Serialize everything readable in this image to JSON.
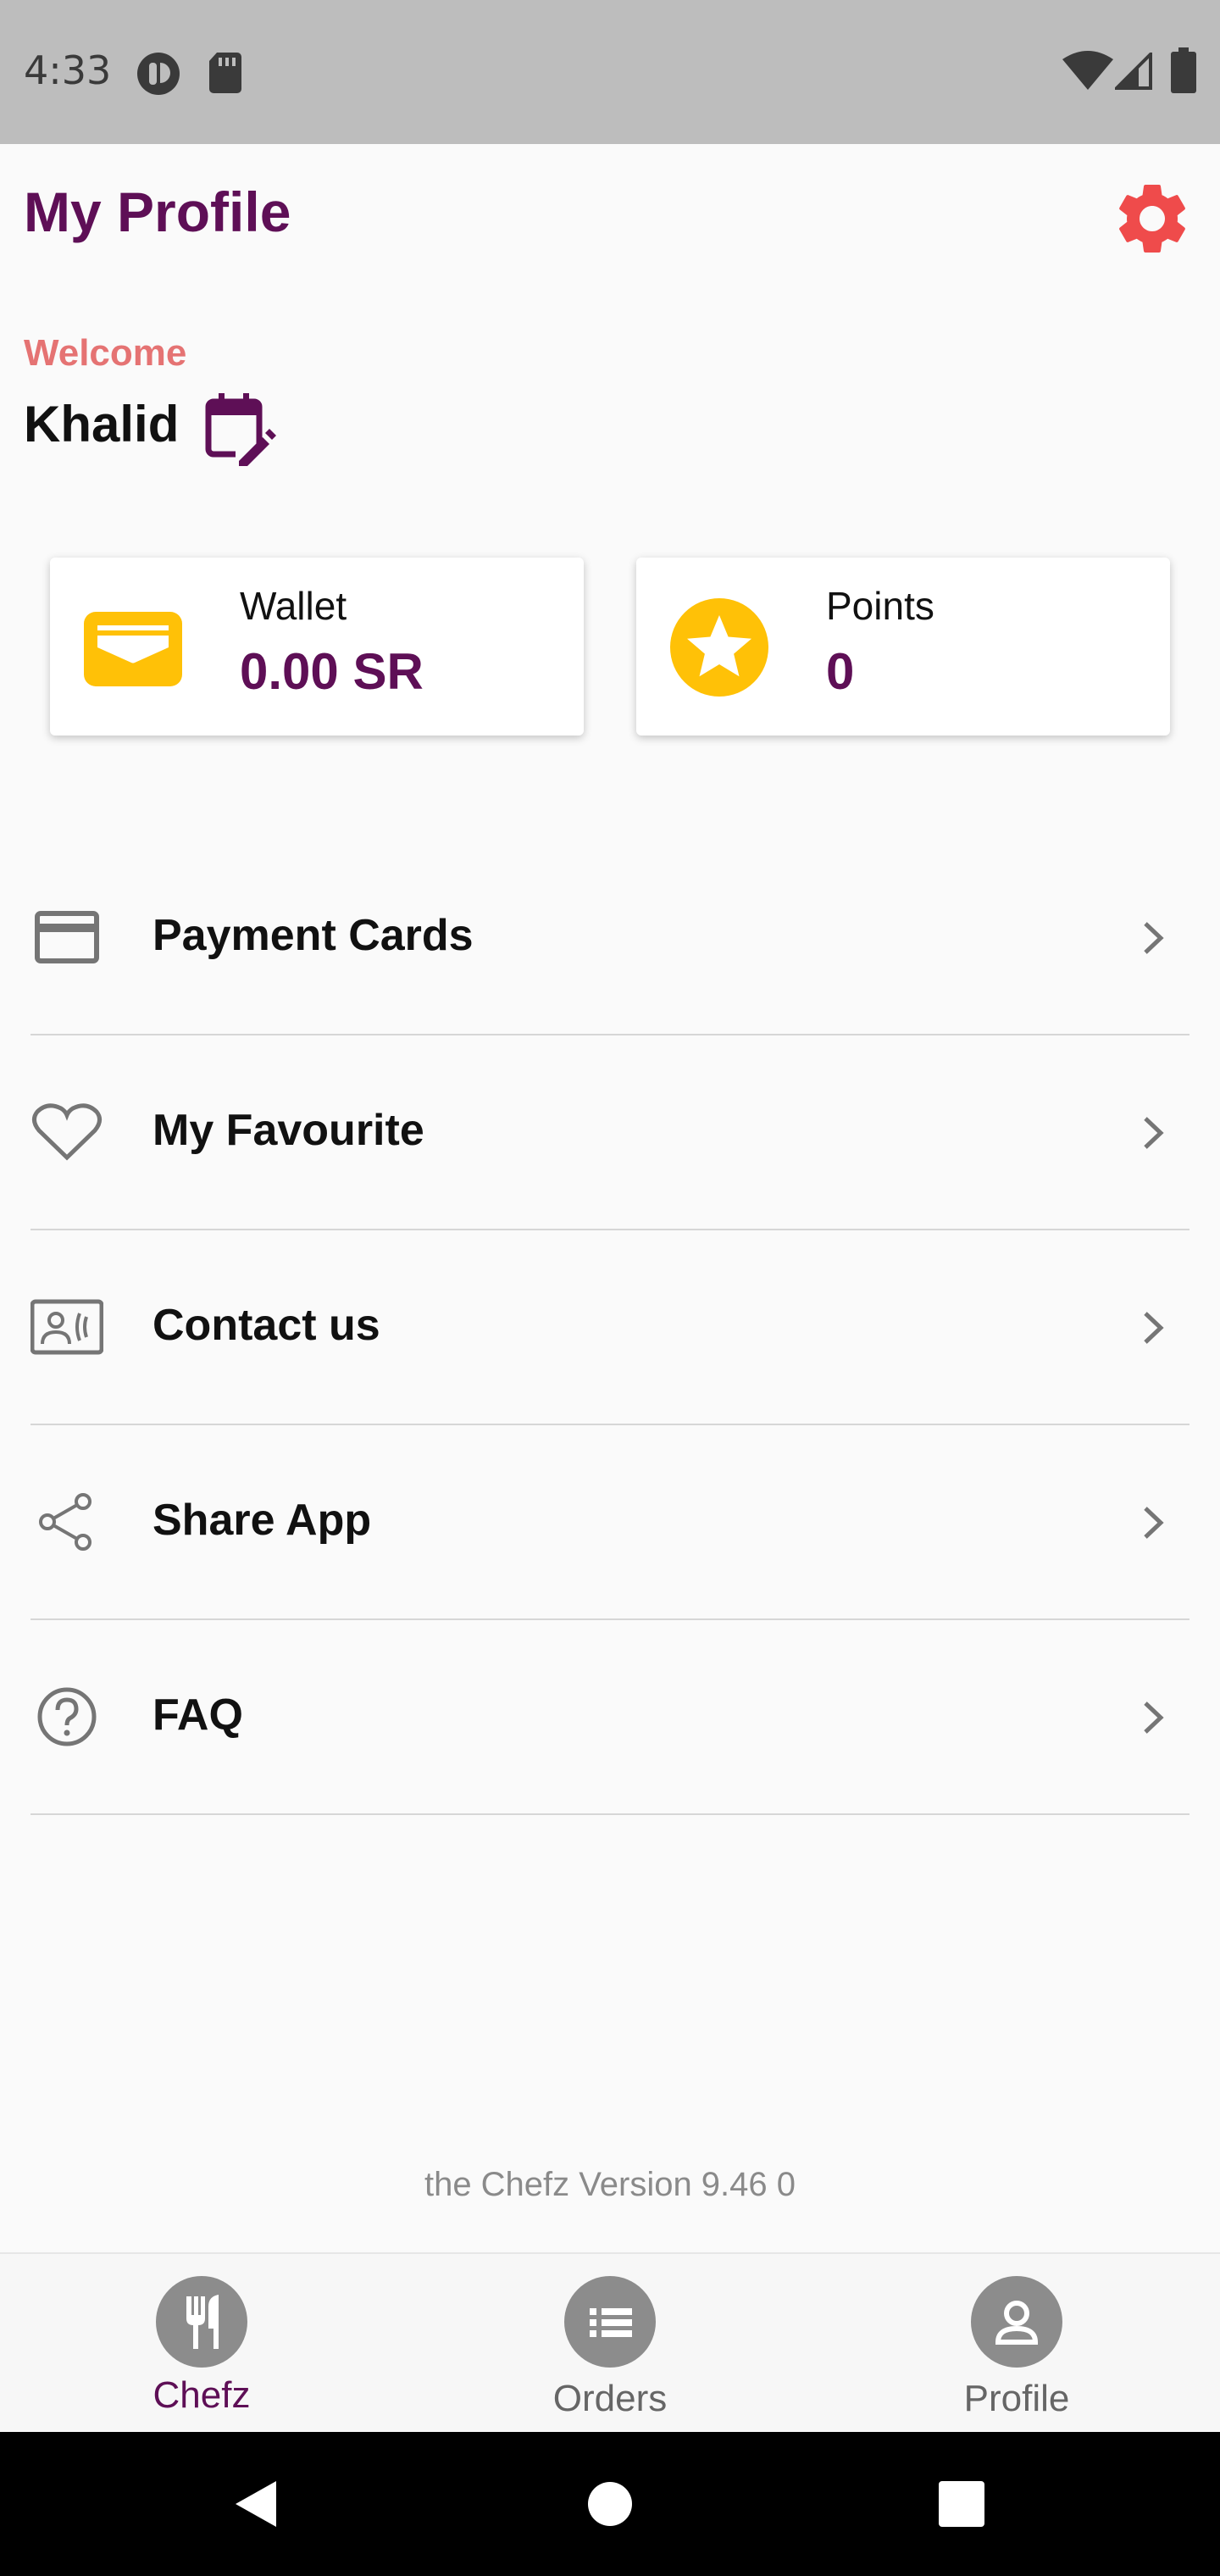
{
  "status_bar": {
    "time": "4:33",
    "icons": [
      "notification-app-icon",
      "sd-card-icon",
      "wifi-icon",
      "signal-icon",
      "battery-icon"
    ]
  },
  "header": {
    "title": "My Profile",
    "settings_icon": "gear-icon"
  },
  "user": {
    "welcome": "Welcome",
    "name": "Khalid",
    "edit_icon": "calendar-edit-icon"
  },
  "cards": {
    "wallet": {
      "label": "Wallet",
      "value": "0.00 SR",
      "icon": "wallet-icon"
    },
    "points": {
      "label": "Points",
      "value": "0",
      "icon": "star-icon"
    }
  },
  "menu": [
    {
      "label": "Payment Cards",
      "icon": "credit-card-icon"
    },
    {
      "label": "My Favourite",
      "icon": "heart-icon"
    },
    {
      "label": "Contact us",
      "icon": "contact-card-icon"
    },
    {
      "label": "Share App",
      "icon": "share-icon"
    },
    {
      "label": "FAQ",
      "icon": "help-circle-icon"
    }
  ],
  "footer": {
    "version": "the Chefz Version 9.46 0"
  },
  "bottom_nav": [
    {
      "label": "Chefz",
      "icon": "fork-knife-icon",
      "active": true
    },
    {
      "label": "Orders",
      "icon": "list-icon",
      "active": false
    },
    {
      "label": "Profile",
      "icon": "person-icon",
      "active": false
    }
  ],
  "colors": {
    "brand_purple": "#5e0f56",
    "accent_red": "#ef4b4b",
    "welcome_pink": "#e57373",
    "gold": "#ffc107"
  }
}
